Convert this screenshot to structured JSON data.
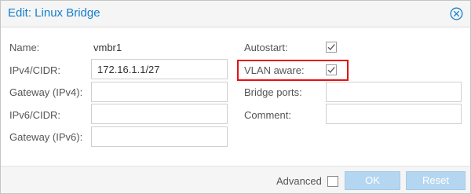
{
  "dialog": {
    "title": "Edit: Linux Bridge"
  },
  "form": {
    "name": {
      "label": "Name:",
      "value": "vmbr1"
    },
    "ipv4": {
      "label": "IPv4/CIDR:",
      "value": "172.16.1.1/27"
    },
    "gateway_ipv4": {
      "label": "Gateway (IPv4):",
      "value": ""
    },
    "ipv6": {
      "label": "IPv6/CIDR:",
      "value": ""
    },
    "gateway_ipv6": {
      "label": "Gateway (IPv6):",
      "value": ""
    },
    "autostart": {
      "label": "Autostart:",
      "checked": true
    },
    "vlan_aware": {
      "label": "VLAN aware:",
      "checked": true
    },
    "bridge_ports": {
      "label": "Bridge ports:",
      "value": ""
    },
    "comment": {
      "label": "Comment:",
      "value": ""
    }
  },
  "footer": {
    "advanced_label": "Advanced",
    "advanced_checked": false,
    "ok_label": "OK",
    "reset_label": "Reset"
  },
  "colors": {
    "title": "#157fcc",
    "button_disabled": "#b5d6f0",
    "highlight": "#e31212"
  },
  "icons": {
    "close": "close-circle-icon",
    "check": "checkmark-icon"
  }
}
